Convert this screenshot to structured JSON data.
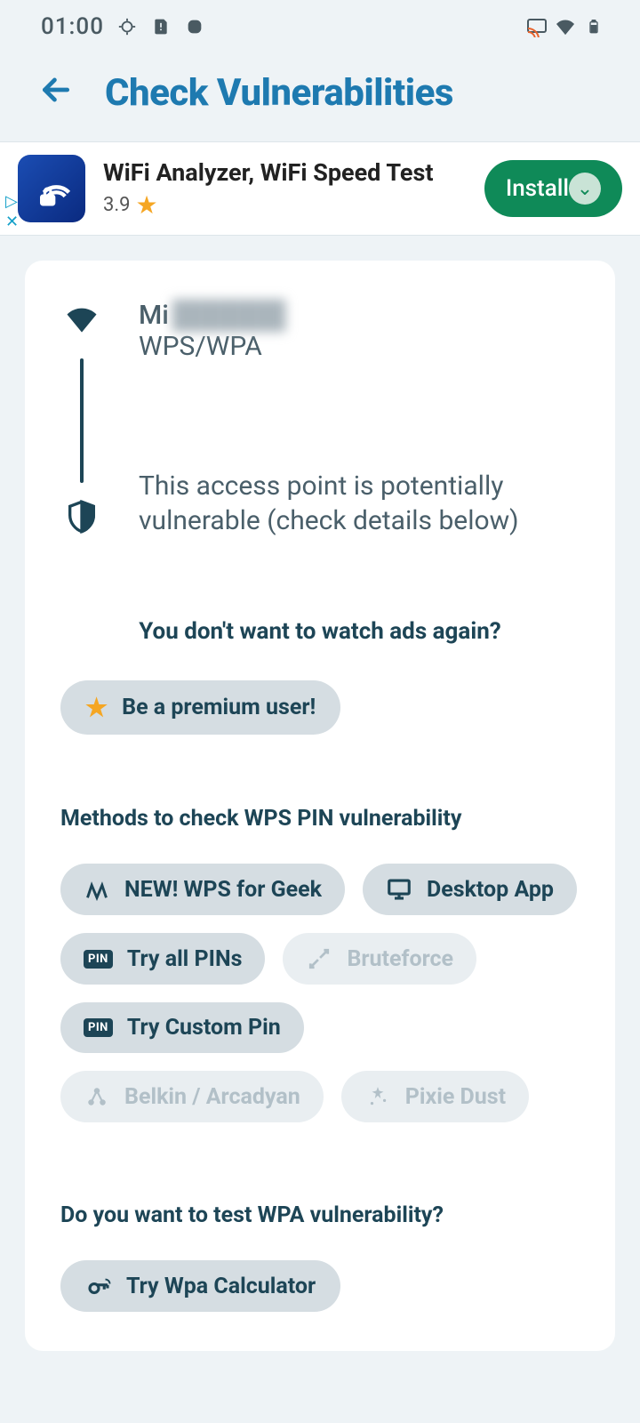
{
  "status": {
    "time": "01:00"
  },
  "header": {
    "title": "Check Vulnerabilities"
  },
  "ad": {
    "title": "WiFi Analyzer, WiFi Speed Test",
    "rating": "3.9",
    "install": "Install"
  },
  "network": {
    "name_prefix": "Mi",
    "name_hidden": "██████",
    "security": "WPS/WPA",
    "vuln_msg": "This access point is potentially vulnerable (check details below)"
  },
  "ads_prompt": "You don't want to watch ads again?",
  "premium_label": "Be a premium user!",
  "wps_section_title": "Methods to check WPS PIN vulnerability",
  "wps_methods": {
    "geek": "NEW! WPS for Geek",
    "desktop": "Desktop App",
    "try_all": "Try all PINs",
    "bruteforce": "Bruteforce",
    "custom": "Try Custom Pin",
    "belkin": "Belkin / Arcadyan",
    "pixie": "Pixie Dust"
  },
  "wpa_section_title": "Do you want to test WPA vulnerability?",
  "wpa_button": "Try Wpa Calculator"
}
